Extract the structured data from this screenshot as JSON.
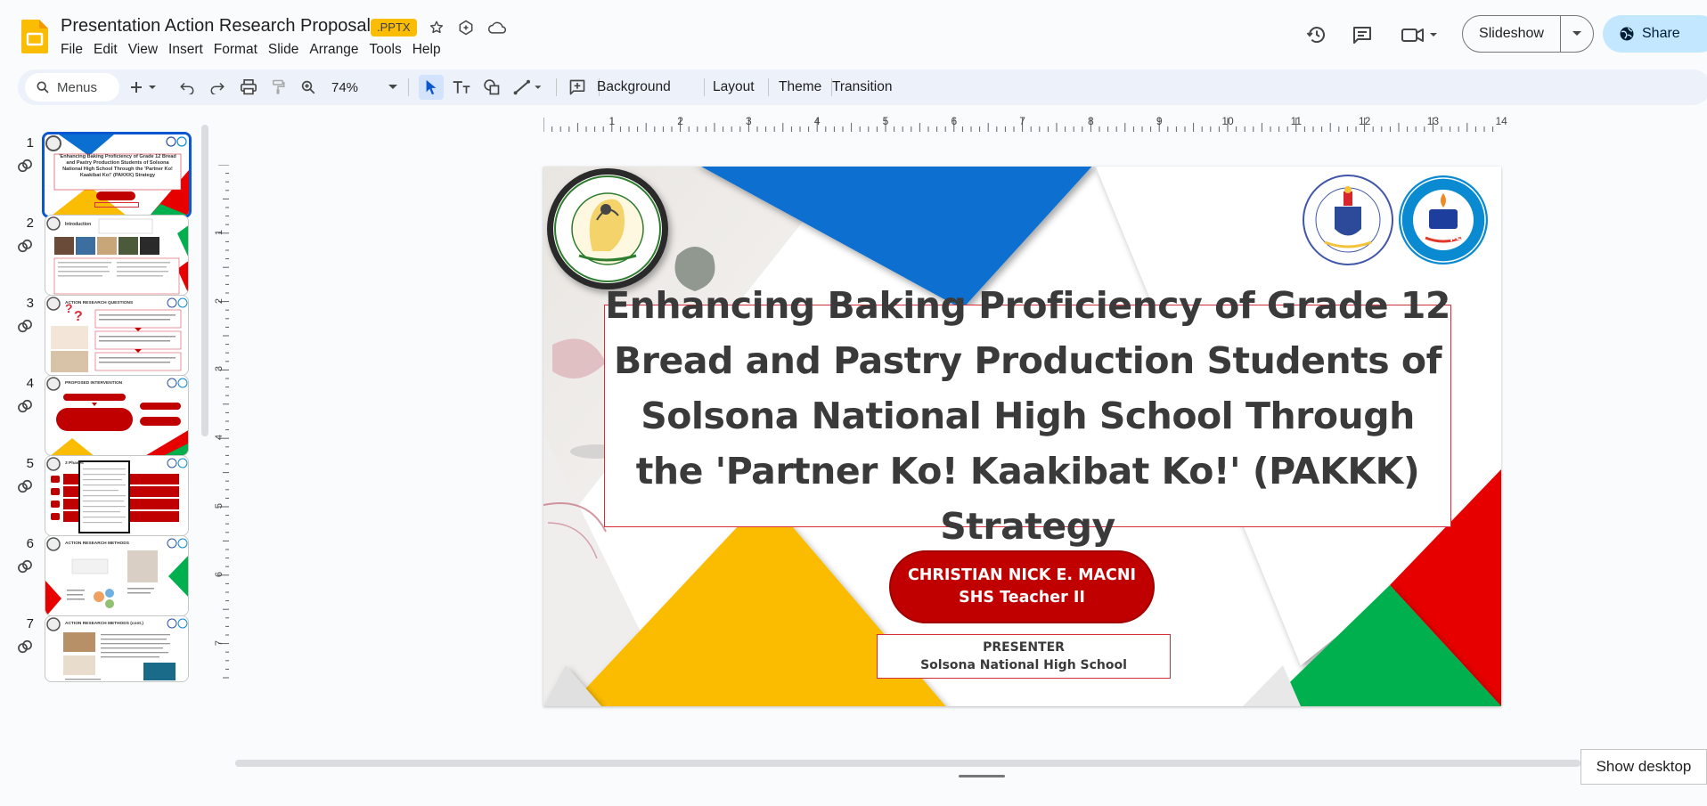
{
  "header": {
    "doc_title": "Presentation Action Research Proposal",
    "file_badge": ".PPTX",
    "menu": [
      "File",
      "Edit",
      "View",
      "Insert",
      "Format",
      "Slide",
      "Arrange",
      "Tools",
      "Help"
    ],
    "slideshow_label": "Slideshow",
    "share_label": "Share"
  },
  "toolbar": {
    "search_label": "Menus",
    "zoom": "74%",
    "background_label": "Background",
    "layout_label": "Layout",
    "theme_label": "Theme",
    "transition_label": "Transition"
  },
  "ruler": {
    "top_marks": [
      "1",
      "2",
      "3",
      "4",
      "5",
      "6",
      "7",
      "8",
      "9",
      "10",
      "11",
      "12",
      "13",
      "14"
    ],
    "left_marks": [
      "1",
      "2",
      "3",
      "4",
      "5",
      "6",
      "7"
    ]
  },
  "filmstrip": {
    "slides": [
      {
        "num": "1",
        "title": "'Enhancing Baking Proficiency of Grade 12 Bread and Pastry Production Students of Solsona National High School Through the 'Partner Ko! Kaakibat Ko!' (PAKKK) Strategy"
      },
      {
        "num": "2",
        "title": "Introduction"
      },
      {
        "num": "3",
        "title": "ACTION RESEARCH QUESTIONS"
      },
      {
        "num": "4",
        "title": "PROPOSED INTERVENTION"
      },
      {
        "num": "5",
        "title": "3 Phases"
      },
      {
        "num": "6",
        "title": "ACTION RESEARCH METHODS"
      },
      {
        "num": "7",
        "title": "ACTION RESEARCH METHODS (cont.)"
      }
    ]
  },
  "slide": {
    "title": "Enhancing Baking Proficiency of Grade 12 Bread and Pastry Production Students of Solsona National High School Through the 'Partner Ko! Kaakibat Ko!' (PAKKK) Strategy",
    "presenter_name": "CHRISTIAN NICK E. MACNI",
    "presenter_role": "SHS Teacher II",
    "presenter_label": "PRESENTER",
    "school": "Solsona National High School",
    "logos": {
      "deped_division": "DEPARTMENT OF EDUCATION · SCHOOLS DIVISION OF ILOCOS NORTE",
      "kagawaran": "KAGAWARAN NG EDUKASYON · REPUBLIKA NG PILIPINAS",
      "school_seal": "SOLSONA NATIONAL HIGH SCHOOL · SOLSONA, ILOCOS NORTE",
      "school_seal_inner": "DepED"
    }
  },
  "taskbar": {
    "show_desktop": "Show desktop"
  },
  "colors": {
    "accent_blue": "#0b57d0",
    "share_bg": "#c2e7ff",
    "slide_red": "#c00000",
    "slide_yellow": "#fbbc04",
    "slide_blue": "#0a6fd0",
    "slide_green": "#00b04f"
  }
}
